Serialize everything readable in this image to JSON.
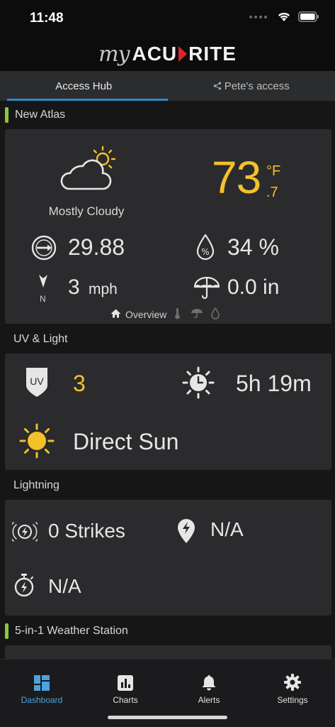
{
  "status_bar": {
    "time": "11:48"
  },
  "header": {
    "logo_my": "my",
    "logo_acu": "ACU",
    "logo_rite": "RITE"
  },
  "tabs": [
    {
      "label": "Access Hub",
      "active": true
    },
    {
      "label": "Pete's access",
      "active": false
    }
  ],
  "atlas": {
    "title": "New Atlas",
    "condition": "Mostly Cloudy",
    "temperature": "73",
    "temperature_unit": "°F",
    "temperature_decimal": ".7",
    "pressure": "29.88",
    "humidity": "34 %",
    "wind_direction": "N",
    "wind_speed": "3",
    "wind_unit": "mph",
    "rain": "0.0 in",
    "overview_label": "Overview"
  },
  "uv_light": {
    "title": "UV & Light",
    "uv_badge": "UV",
    "uv_index": "3",
    "light_duration": "5h 19m",
    "light_condition": "Direct Sun"
  },
  "lightning": {
    "title": "Lightning",
    "strikes": "0 Strikes",
    "distance": "N/A",
    "last_strike": "N/A"
  },
  "weather_station": {
    "title": "5-in-1 Weather Station"
  },
  "bottom_nav": [
    {
      "label": "Dashboard",
      "icon": "dashboard-icon",
      "active": true
    },
    {
      "label": "Charts",
      "icon": "charts-icon",
      "active": false
    },
    {
      "label": "Alerts",
      "icon": "bell-icon",
      "active": false
    },
    {
      "label": "Settings",
      "icon": "gear-icon",
      "active": false
    }
  ],
  "colors": {
    "accent_yellow": "#f3c12a",
    "accent_blue": "#4aa3df",
    "section_green": "#8cc63f",
    "brand_red": "#d8262c"
  }
}
